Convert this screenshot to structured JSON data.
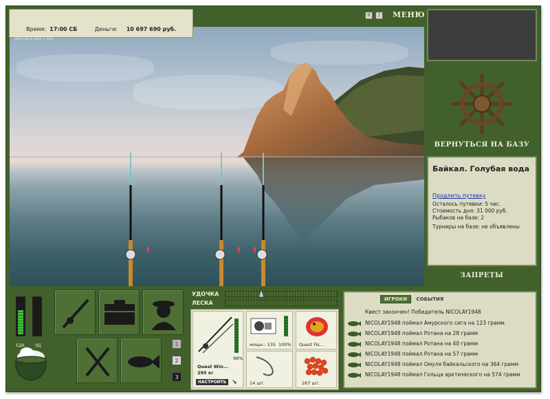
{
  "status": {
    "time_label": "Время:",
    "time_value": "17:00 СБ",
    "money_label": "Деньги:",
    "money_value": "10 697 690 руб."
  },
  "watermark": "INSTALLSOFT.RU",
  "topbar": {
    "pause_icon": "pause-icon",
    "sound_icon": "sound-icon",
    "menu_label": "МЕНЮ"
  },
  "right_panel": {
    "return_label": "ВЕРНУТЬСЯ НА БАЗУ",
    "location_title": "Байкал. Голубая вода",
    "extend_link": "Продлить путевку",
    "info_lines": [
      "Осталось путевки: 5 час.",
      "Стоимость дня: 31 000 руб.",
      "Рыбаков на базе: 2",
      "Турниры на базе: не объявлены"
    ],
    "bans_label": "ЗАПРЕТЫ"
  },
  "meters": {
    "food_label": "ЕДА",
    "poison_label": "ЯД",
    "food_level": 0.62,
    "poison_level": 0.0
  },
  "side_numbers": [
    "1",
    "2",
    "3"
  ],
  "sliders": {
    "rod_label": "УДОЧКА",
    "line_label": "ЛЕСКА"
  },
  "tackle": {
    "rod_name": "Quest Win...",
    "rod_weight": "295 кг",
    "rod_condition": "98%",
    "setup_button": "НАСТРОИТЬ",
    "reel_power": "мощн.: 135",
    "reel_condition": "100%",
    "lure_name": "Quest Fis...",
    "hook_count": "14 шт.",
    "bait_count": "267 шт."
  },
  "events": {
    "tabs": [
      "ИГРОКИ",
      "СОБЫТИЯ"
    ],
    "active_tab": "ИГРОКИ",
    "header": "Квест закончен! Победитель NICOLAY1948",
    "items": [
      "NICOLAY1948 поймал Амурского сига на 123 грамм",
      "NICOLAY1948 поймал Ротана на 28 грамм",
      "NICOLAY1948 поймал Ротана на 40 грамм",
      "NICOLAY1948 поймал Ротана на 57 грамм",
      "NICOLAY1948 поймал Омуля байкальского на 364 грамм",
      "NICOLAY1948 поймал Гольца арктического на 574 грамм"
    ]
  },
  "colors": {
    "frame": "#41602b",
    "panel": "#dcdcc4",
    "link": "#1a2fb3"
  }
}
